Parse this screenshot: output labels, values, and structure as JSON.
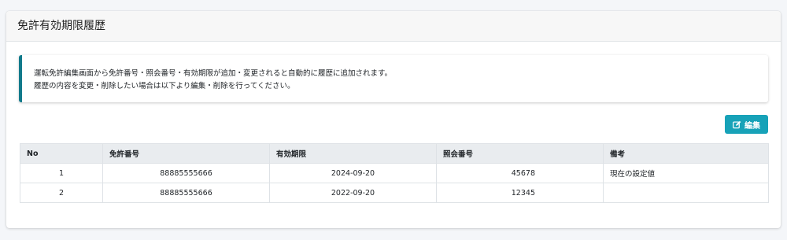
{
  "card": {
    "title": "免許有効期限履歴"
  },
  "callout": {
    "line1": "運転免許編集画面から免許番号・照会番号・有効期限が追加・変更されると自動的に履歴に追加されます。",
    "line2": "履歴の内容を変更・削除したい場合は以下より編集・削除を行ってください。"
  },
  "edit_button": {
    "label": "編集",
    "icon": "edit-icon",
    "color": "#17a2b8"
  },
  "table": {
    "headers": [
      "No",
      "免許番号",
      "有効期限",
      "照会番号",
      "備考"
    ],
    "rows": [
      [
        "1",
        "88885555666",
        "2024-09-20",
        "45678",
        "現在の設定値"
      ],
      [
        "2",
        "88885555666",
        "2022-09-20",
        "12345",
        ""
      ]
    ]
  },
  "colors": {
    "accent_border": "#117a8b",
    "header_bg": "#e9ecef"
  }
}
